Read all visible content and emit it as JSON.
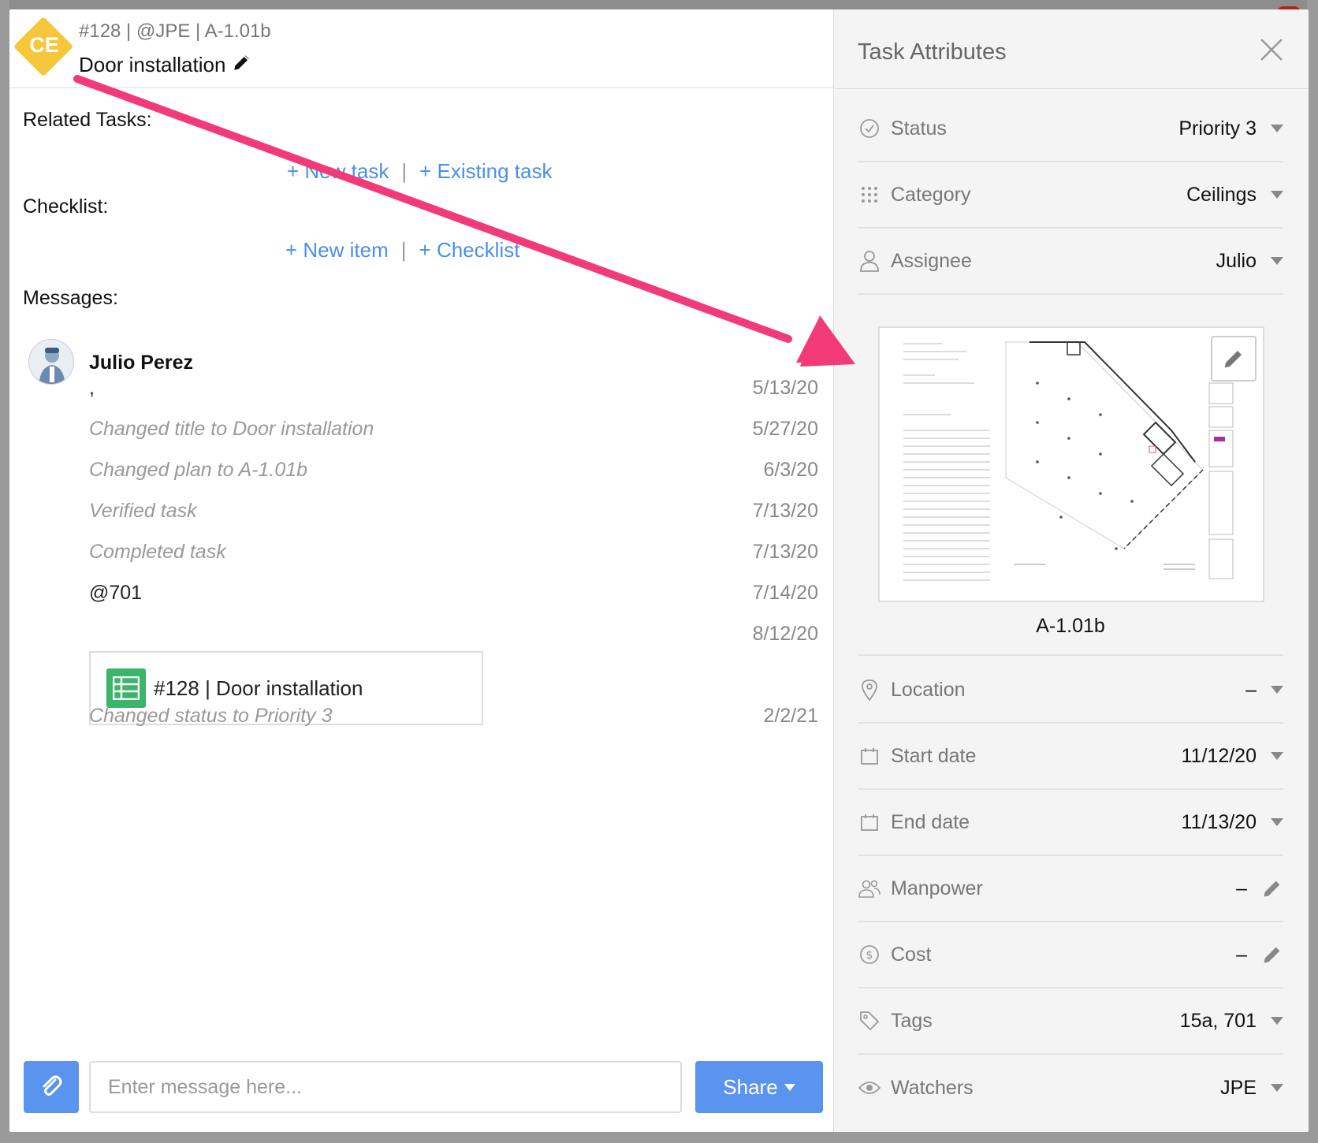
{
  "task": {
    "badge": "CE",
    "meta": "#128 | @JPE | A-1.01b",
    "title": "Door installation"
  },
  "sections": {
    "related_tasks": "Related Tasks:",
    "checklist": "Checklist:",
    "messages": "Messages:"
  },
  "related_links": {
    "new_task": "+ New task",
    "existing_task": "+ Existing task",
    "separator": "|"
  },
  "checklist_links": {
    "new_item": "+ New item",
    "checklist": "+ Checklist",
    "separator": "|"
  },
  "messages": {
    "author": "Julio Perez",
    "items": [
      {
        "text": ",",
        "date": "5/13/20"
      },
      {
        "text": "Changed title to Door installation",
        "date": "5/27/20"
      },
      {
        "text": "Changed plan to A-1.01b",
        "date": "6/3/20"
      },
      {
        "text": "Verified task",
        "date": "7/13/20"
      },
      {
        "text": "Completed task",
        "date": "7/13/20"
      },
      {
        "text": "@701",
        "date": "7/14/20"
      },
      {
        "text": "",
        "date": "8/12/20"
      },
      {
        "text": "Changed status to Priority 3",
        "date": "2/2/21"
      }
    ],
    "task_card": "#128 | Door installation"
  },
  "composer": {
    "placeholder": "Enter message here...",
    "share_label": "Share"
  },
  "panel": {
    "title": "Task Attributes",
    "attributes": [
      {
        "name": "Status",
        "value": "Priority 3",
        "icon": "check-circle-icon"
      },
      {
        "name": "Category",
        "value": "Ceilings",
        "icon": "grid-dots-icon"
      },
      {
        "name": "Assignee",
        "value": "Julio",
        "icon": "person-icon"
      },
      {
        "name": "Location",
        "value": "–",
        "icon": "map-pin-icon"
      },
      {
        "name": "Start date",
        "value": "11/12/20",
        "icon": "calendar-icon"
      },
      {
        "name": "End date",
        "value": "11/13/20",
        "icon": "calendar-icon"
      },
      {
        "name": "Manpower",
        "value": "–",
        "icon": "people-icon"
      },
      {
        "name": "Cost",
        "value": "–",
        "icon": "dollar-icon"
      },
      {
        "name": "Tags",
        "value": "15a, 701",
        "icon": "tag-icon"
      },
      {
        "name": "Watchers",
        "value": "JPE",
        "icon": "eye-icon"
      }
    ],
    "plan_label": "A-1.01b"
  },
  "colors": {
    "accent": "#5b94ee",
    "link": "#4a8fe8",
    "badge": "#f6c73b",
    "annotation_arrow": "#f23a78",
    "sheet_icon": "#3bb56a"
  }
}
